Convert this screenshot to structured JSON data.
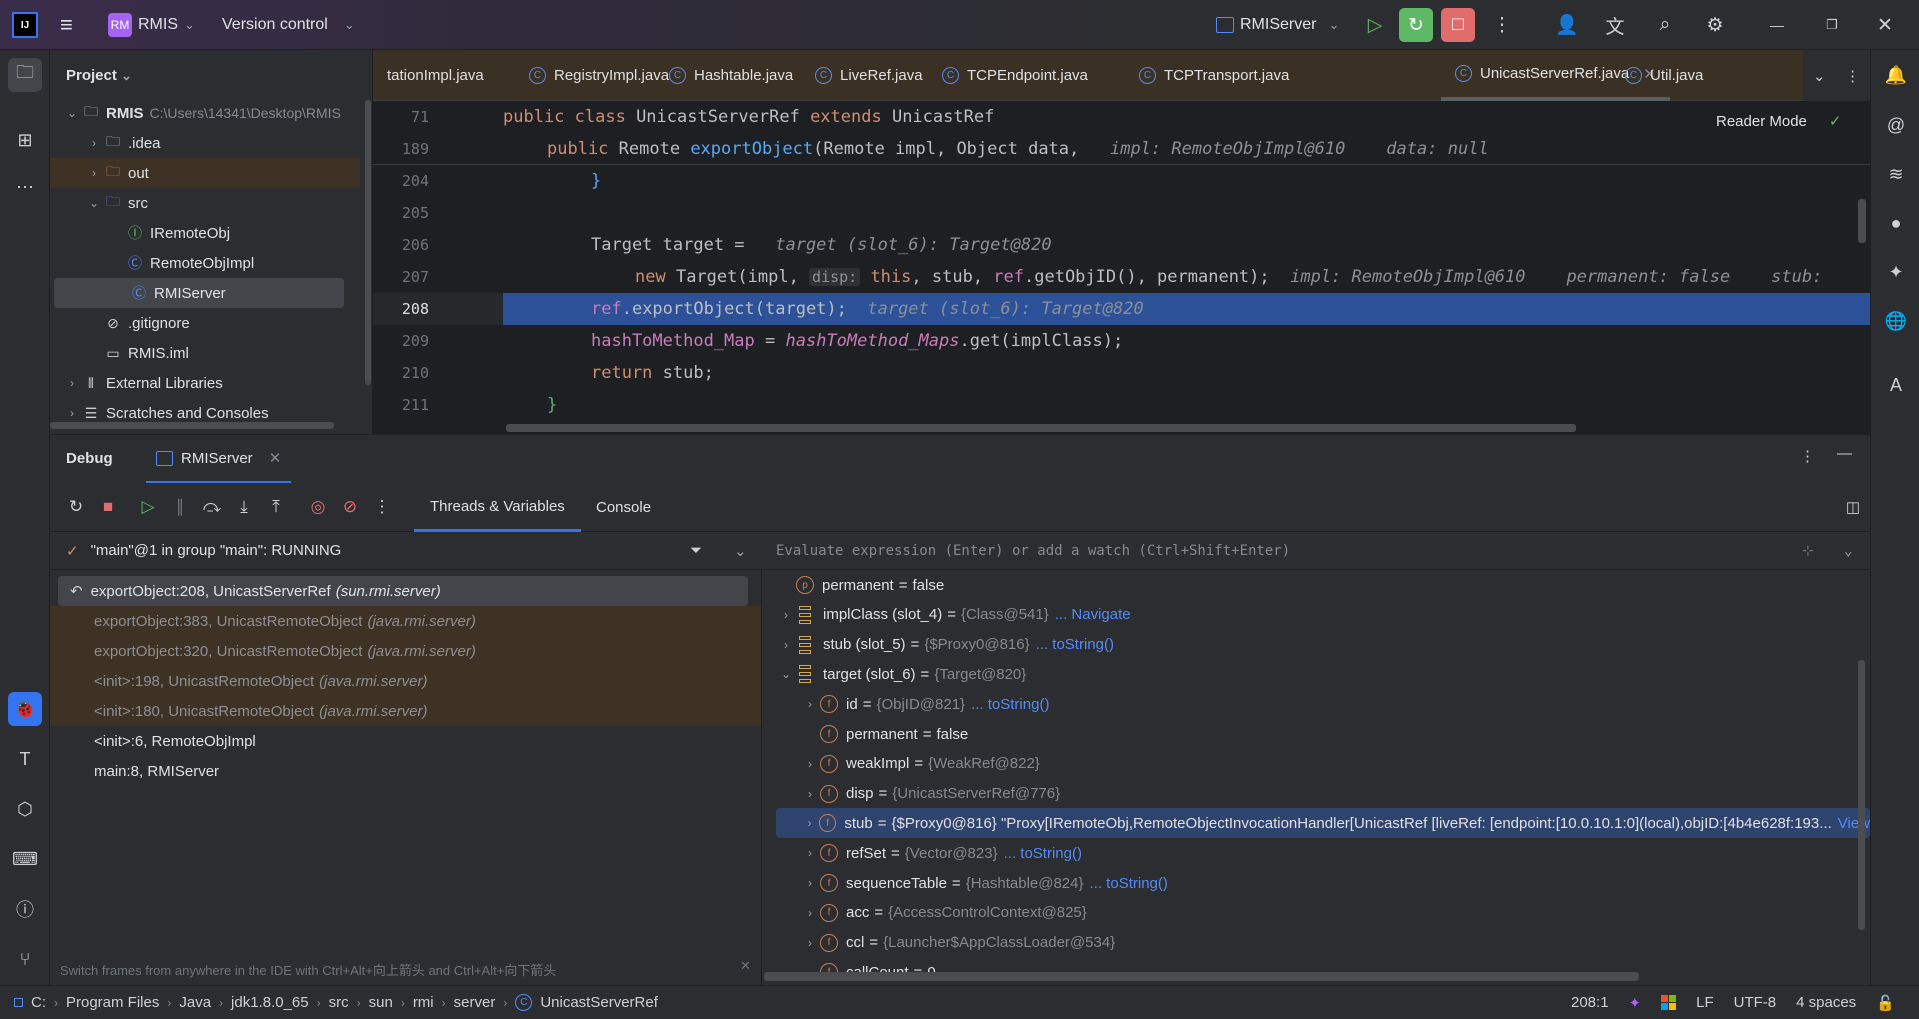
{
  "titlebar": {
    "project_badge": "RM",
    "project": "RMIS",
    "vcs": "Version control",
    "run_config": "RMIServer"
  },
  "project_panel": {
    "title": "Project",
    "tree": [
      {
        "depth": 0,
        "arrow": "down",
        "icon": "project",
        "label": "RMIS",
        "path": "C:\\Users\\14341\\Desktop\\RMIS",
        "bold": true
      },
      {
        "depth": 1,
        "arrow": "right",
        "icon": "folder",
        "label": ".idea"
      },
      {
        "depth": 1,
        "arrow": "right",
        "icon": "folder-excluded",
        "label": "out",
        "excluded": true
      },
      {
        "depth": 1,
        "arrow": "down",
        "icon": "folder-source",
        "label": "src"
      },
      {
        "depth": 2,
        "arrow": "",
        "icon": "interface",
        "label": "IRemoteObj"
      },
      {
        "depth": 2,
        "arrow": "",
        "icon": "class",
        "label": "RemoteObjImpl"
      },
      {
        "depth": 2,
        "arrow": "",
        "icon": "class-runnable",
        "label": "RMIServer",
        "selected": true
      },
      {
        "depth": 1,
        "arrow": "",
        "icon": "ignore-file",
        "label": ".gitignore"
      },
      {
        "depth": 1,
        "arrow": "",
        "icon": "module-file",
        "label": "RMIS.iml"
      },
      {
        "depth": 0,
        "arrow": "right",
        "icon": "libraries",
        "label": "External Libraries"
      },
      {
        "depth": 0,
        "arrow": "right",
        "icon": "scratches",
        "label": "Scratches and Consoles"
      }
    ]
  },
  "editor": {
    "tabs": [
      {
        "label": "tationImpl.java",
        "icon": ""
      },
      {
        "label": "RegistryImpl.java",
        "icon": "class"
      },
      {
        "label": "Hashtable.java",
        "icon": "class"
      },
      {
        "label": "LiveRef.java",
        "icon": "class"
      },
      {
        "label": "TCPEndpoint.java",
        "icon": "class"
      },
      {
        "label": "TCPTransport.java",
        "icon": "class"
      },
      {
        "label": "UnicastServerRef.java",
        "icon": "class",
        "active": true
      },
      {
        "label": "Util.java",
        "icon": "class"
      }
    ],
    "reader_mode": "Reader Mode",
    "lines": [
      {
        "num": "71",
        "indent": 0,
        "tokens": [
          [
            "public class ",
            "kw"
          ],
          [
            "UnicastServerRef ",
            "id"
          ],
          [
            "extends ",
            "kw"
          ],
          [
            "UnicastRef",
            "id"
          ]
        ]
      },
      {
        "num": "189",
        "indent": 1,
        "tokens": [
          [
            "public ",
            "kw"
          ],
          [
            "Remote ",
            "id"
          ],
          [
            "exportObject",
            "fn"
          ],
          [
            "(",
            "id"
          ],
          [
            "Remote impl, Object data,",
            "id"
          ],
          [
            "   impl: RemoteObjImpl@610    data: null",
            "hint"
          ]
        ]
      },
      {
        "num": "204",
        "indent": 2,
        "tokens": [
          [
            "}",
            "br"
          ]
        ]
      },
      {
        "num": "205",
        "indent": 2,
        "tokens": []
      },
      {
        "num": "206",
        "indent": 2,
        "tokens": [
          [
            "Target target = ",
            "id"
          ],
          [
            "  target (slot_6): Target@820",
            "hint"
          ]
        ]
      },
      {
        "num": "207",
        "indent": 3,
        "tokens": [
          [
            "new ",
            "kw"
          ],
          [
            "Target",
            "id"
          ],
          [
            "(",
            "id"
          ],
          [
            "impl, ",
            "id"
          ],
          [
            "disp:",
            "inlay"
          ],
          [
            " this",
            "kw"
          ],
          [
            ", stub, ",
            "id"
          ],
          [
            "ref",
            "fld"
          ],
          [
            ".getObjID(), permanent);",
            "id"
          ],
          [
            "  impl: RemoteObjImpl@610    permanent: false    stub: ",
            "hint"
          ]
        ]
      },
      {
        "num": "208",
        "indent": 2,
        "current": true,
        "tokens": [
          [
            "ref",
            "fld"
          ],
          [
            ".exportObject(target);",
            "id"
          ],
          [
            "  target (slot_6): Target@820",
            "hint"
          ]
        ]
      },
      {
        "num": "209",
        "indent": 2,
        "tokens": [
          [
            "hashToMethod_Map",
            "fld"
          ],
          [
            " = ",
            "id"
          ],
          [
            "hashToMethod_Maps",
            "sfld"
          ],
          [
            ".get(implClass);",
            "id"
          ]
        ]
      },
      {
        "num": "210",
        "indent": 2,
        "tokens": [
          [
            "return ",
            "kw"
          ],
          [
            "stub;",
            "id"
          ]
        ]
      },
      {
        "num": "211",
        "indent": 1,
        "tokens": [
          [
            "}",
            "br2"
          ]
        ]
      }
    ]
  },
  "debug": {
    "title": "Debug",
    "session_tab": "RMIServer",
    "view_tabs": [
      "Threads & Variables",
      "Console"
    ],
    "thread": "\"main\"@1 in group \"main\": RUNNING",
    "frames": [
      {
        "method": "exportObject:208, UnicastServerRef",
        "pkg": "(sun.rmi.server)",
        "selected": true,
        "library": false
      },
      {
        "method": "exportObject:383, UnicastRemoteObject",
        "pkg": "(java.rmi.server)",
        "library": true
      },
      {
        "method": "exportObject:320, UnicastRemoteObject",
        "pkg": "(java.rmi.server)",
        "library": true
      },
      {
        "method": "<init>:198, UnicastRemoteObject",
        "pkg": "(java.rmi.server)",
        "library": true
      },
      {
        "method": "<init>:180, UnicastRemoteObject",
        "pkg": "(java.rmi.server)",
        "library": true
      },
      {
        "method": "<init>:6, RemoteObjImpl",
        "pkg": "",
        "library": false
      },
      {
        "method": "main:8, RMIServer",
        "pkg": "",
        "library": false
      }
    ],
    "hint": "Switch frames from anywhere in the IDE with Ctrl+Alt+向上箭头 and Ctrl+Alt+向下箭头",
    "eval_placeholder": "Evaluate expression (Enter) or add a watch (Ctrl+Shift+Enter)",
    "variables": [
      {
        "depth": 0,
        "arrow": "",
        "icon": "param",
        "name": "permanent",
        "value": "false",
        "type": "",
        "link": ""
      },
      {
        "depth": 0,
        "arrow": "right",
        "icon": "local",
        "name": "implClass (slot_4)",
        "value": "",
        "type": "{Class@541}",
        "link": "... Navigate"
      },
      {
        "depth": 0,
        "arrow": "right",
        "icon": "local",
        "name": "stub (slot_5)",
        "value": "",
        "type": "{$Proxy0@816}",
        "link": "... toString()"
      },
      {
        "depth": 0,
        "arrow": "down",
        "icon": "local",
        "name": "target (slot_6)",
        "value": "",
        "type": "{Target@820}",
        "link": ""
      },
      {
        "depth": 1,
        "arrow": "right",
        "icon": "field-final",
        "name": "id",
        "value": "",
        "type": "{ObjID@821}",
        "link": "... toString()"
      },
      {
        "depth": 1,
        "arrow": "",
        "icon": "field-final",
        "name": "permanent",
        "value": "false",
        "type": "",
        "link": ""
      },
      {
        "depth": 1,
        "arrow": "right",
        "icon": "field-final",
        "name": "weakImpl",
        "value": "",
        "type": "{WeakRef@822}",
        "link": ""
      },
      {
        "depth": 1,
        "arrow": "right",
        "icon": "field",
        "name": "disp",
        "value": "",
        "type": "{UnicastServerRef@776}",
        "link": ""
      },
      {
        "depth": 1,
        "arrow": "right",
        "icon": "field-final",
        "name": "stub",
        "value": "{$Proxy0@816} \"Proxy[IRemoteObj,RemoteObjectInvocationHandler[UnicastRef [liveRef: [endpoint:[10.0.10.1:0](local),objID:[4b4e628f:193...",
        "type": "",
        "link": "View",
        "selected": true
      },
      {
        "depth": 1,
        "arrow": "right",
        "icon": "field-final",
        "name": "refSet",
        "value": "",
        "type": "{Vector@823}",
        "link": "... toString()"
      },
      {
        "depth": 1,
        "arrow": "right",
        "icon": "field-final",
        "name": "sequenceTable",
        "value": "",
        "type": "{Hashtable@824}",
        "link": "... toString()"
      },
      {
        "depth": 1,
        "arrow": "right",
        "icon": "field-final",
        "name": "acc",
        "value": "",
        "type": "{AccessControlContext@825}",
        "link": ""
      },
      {
        "depth": 1,
        "arrow": "right",
        "icon": "field-final",
        "name": "ccl",
        "value": "",
        "type": "{Launcher$AppClassLoader@534}",
        "link": ""
      },
      {
        "depth": 1,
        "arrow": "",
        "icon": "field",
        "name": "callCount",
        "value": "0",
        "type": "",
        "link": ""
      }
    ]
  },
  "statusbar": {
    "breadcrumbs": [
      "C:",
      "Program Files",
      "Java",
      "jdk1.8.0_65",
      "src",
      "sun",
      "rmi",
      "server",
      "UnicastServerRef"
    ],
    "position": "208:1",
    "line_ending": "LF",
    "encoding": "UTF-8",
    "indent": "4 spaces"
  },
  "colors": {
    "accent": "#3574f0",
    "current_line": "#2d5199",
    "library_frame": "#3d3223",
    "run_green": "#5fb865",
    "stop_red": "#e06c6c"
  }
}
